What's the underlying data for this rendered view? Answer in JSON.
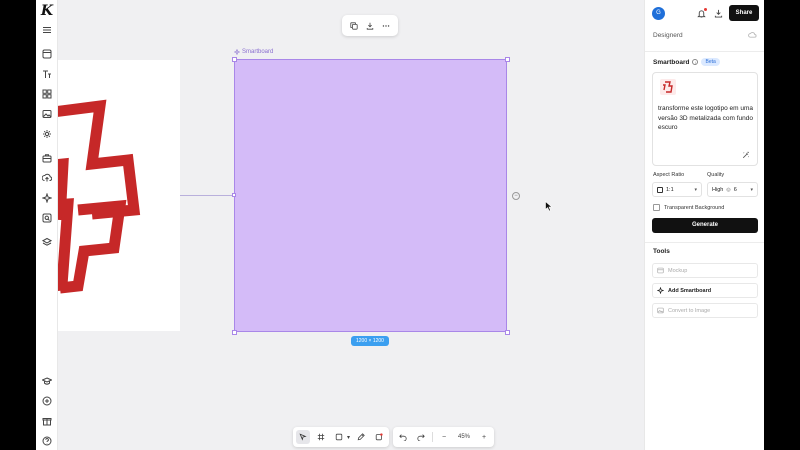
{
  "app": {
    "logo_letter": "K"
  },
  "rail": {
    "icons": [
      "menu-icon",
      "frame-icon",
      "text-icon",
      "components-icon",
      "image-icon",
      "settings-icon",
      "briefcase-icon",
      "upload-icon",
      "sparkle-icon",
      "search-image-icon",
      "layers-icon",
      "learn-icon",
      "add-circle-icon",
      "gift-icon",
      "help-icon"
    ]
  },
  "top_toolbar": {
    "icons": [
      "duplicate-icon",
      "download-icon",
      "more-icon"
    ]
  },
  "canvas": {
    "smartboard_label": "Smartboard",
    "size_badge": "1200 × 1200",
    "side_dot": "−"
  },
  "bottom_toolbar": {
    "tools": [
      "select-icon",
      "frame-tool-icon",
      "shape-icon",
      "pen-icon",
      "smartboard-tool-icon"
    ],
    "undo": "undo-icon",
    "redo": "redo-icon",
    "zoom_out": "−",
    "zoom_value": "45%",
    "zoom_in": "+"
  },
  "header": {
    "avatar_letter": "G",
    "share_label": "Share"
  },
  "project": {
    "name": "Designerd"
  },
  "smartboard_panel": {
    "title": "Smartboard",
    "info": "i",
    "badge": "Beta",
    "prompt": "transforme este logotipo em uma versão 3D metalizada com fundo escuro",
    "aspect_ratio_label": "Aspect Ratio",
    "aspect_ratio_value": "1:1",
    "quality_label": "Quality",
    "quality_value": "High",
    "quality_credits": "6",
    "transparent_label": "Transparent Background",
    "generate_label": "Generate"
  },
  "tools_panel": {
    "title": "Tools",
    "items": [
      {
        "label": "Mockup",
        "enabled": false
      },
      {
        "label": "Add Smartboard",
        "enabled": true
      },
      {
        "label": "Convert to Image",
        "enabled": false
      }
    ]
  },
  "colors": {
    "smartboard_fill": "#d4bbf8",
    "smartboard_border": "#a987e8",
    "logo_red": "#c62828",
    "accent_blue": "#3b9ff0",
    "dark": "#111111"
  }
}
